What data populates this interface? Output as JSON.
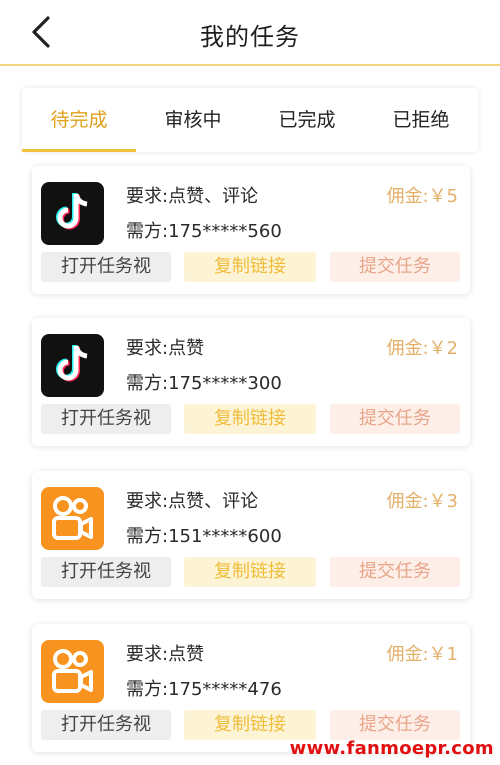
{
  "header": {
    "title": "我的任务",
    "back_icon": "chevron-left-icon"
  },
  "tabs": [
    {
      "label": "待完成",
      "active": true
    },
    {
      "label": "审核中",
      "active": false
    },
    {
      "label": "已完成",
      "active": false
    },
    {
      "label": "已拒绝",
      "active": false
    }
  ],
  "tasks": [
    {
      "app_icon": "tiktok-icon",
      "requirement": "要求:点赞、评论",
      "requester": "需方:175*****560",
      "fee": "佣金:￥5",
      "open_label": "打开任务视",
      "copy_label": "复制链接",
      "submit_label": "提交任务"
    },
    {
      "app_icon": "tiktok-icon",
      "requirement": "要求:点赞",
      "requester": "需方:175*****300",
      "fee": "佣金:￥2",
      "open_label": "打开任务视",
      "copy_label": "复制链接",
      "submit_label": "提交任务"
    },
    {
      "app_icon": "kuaishou-icon",
      "requirement": "要求:点赞、评论",
      "requester": "需方:151*****600",
      "fee": "佣金:￥3",
      "open_label": "打开任务视",
      "copy_label": "复制链接",
      "submit_label": "提交任务"
    },
    {
      "app_icon": "kuaishou-icon",
      "requirement": "要求:点赞",
      "requester": "需方:175*****476",
      "fee": "佣金:￥1",
      "open_label": "打开任务视",
      "copy_label": "复制链接",
      "submit_label": "提交任务"
    }
  ],
  "watermark": "www.fanmoepr.com",
  "colors": {
    "accent": "#f0c33c",
    "fee": "#e3b06a",
    "kuaishou": "#f7931e",
    "tiktok": "#111111",
    "watermark": "#e10f0f"
  }
}
